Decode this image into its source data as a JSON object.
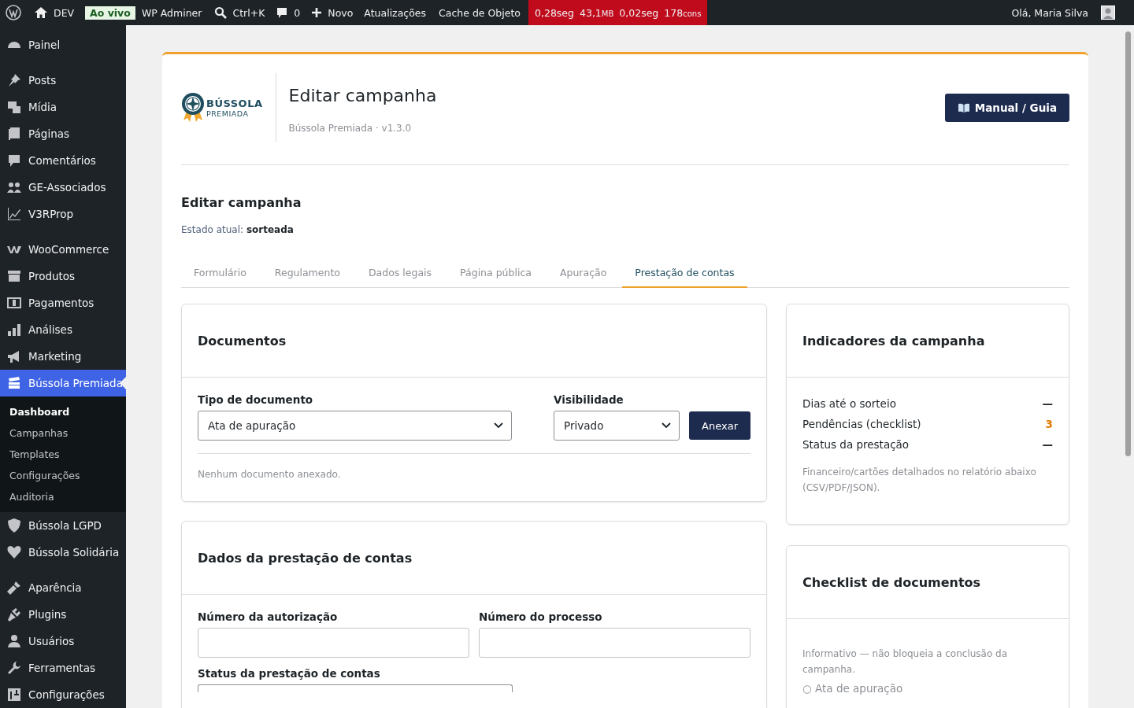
{
  "admin_bar": {
    "site": "DEV",
    "environment_badge": "Ao vivo",
    "adminer": "WP Adminer",
    "search": "Ctrl+K",
    "comments": "0",
    "new": "Novo",
    "links": [
      "Atualizações",
      "Cache de Objeto"
    ],
    "query_monitor": [
      {
        "value": "0,28seg"
      },
      {
        "value": "43,1",
        "unit": "MB"
      },
      {
        "value": "0,02seg"
      },
      {
        "value": "178",
        "unit": "cons"
      }
    ],
    "greeting": "Olá, Maria Silva"
  },
  "sidebar": {
    "groups": [
      [
        {
          "label": "Painel",
          "selected": false
        }
      ],
      [
        {
          "label": "Posts",
          "selected": false
        },
        {
          "label": "Mídia",
          "selected": false
        },
        {
          "label": "Páginas",
          "selected": false
        },
        {
          "label": "Comentários",
          "selected": false
        },
        {
          "label": "GE-Associados",
          "selected": false
        },
        {
          "label": "V3RProp",
          "selected": false
        }
      ],
      [
        {
          "label": "WooCommerce",
          "selected": false
        },
        {
          "label": "Produtos",
          "selected": false
        },
        {
          "label": "Pagamentos",
          "selected": false
        },
        {
          "label": "Análises",
          "selected": false
        },
        {
          "label": "Marketing",
          "selected": false
        },
        {
          "label": "Bússola Premiada",
          "selected": true,
          "children": [
            {
              "label": "Dashboard",
              "selected": true
            },
            {
              "label": "Campanhas",
              "selected": false
            },
            {
              "label": "Templates",
              "selected": false
            },
            {
              "label": "Configurações",
              "selected": false
            },
            {
              "label": "Auditoria",
              "selected": false
            }
          ]
        },
        {
          "label": "Bússola LGPD",
          "selected": false
        },
        {
          "label": "Bússola Solidária",
          "selected": false
        }
      ],
      [
        {
          "label": "Aparência",
          "selected": false
        },
        {
          "label": "Plugins",
          "selected": false
        },
        {
          "label": "Usuários",
          "selected": false
        },
        {
          "label": "Ferramentas",
          "selected": false
        },
        {
          "label": "Configurações",
          "selected": false
        }
      ]
    ]
  },
  "header": {
    "logo_name": "BÚSSOLA",
    "logo_sub": "PREMIADA",
    "title": "Editar campanha",
    "subtitle": "Bússola Premiada · v1.3.0",
    "guide_button": "Manual / Guia"
  },
  "section": {
    "title": "Editar campanha",
    "status": "Estado atual: **sorteada**"
  },
  "tabs": [
    {
      "label": "Formulário",
      "selected": false
    },
    {
      "label": "Regulamento",
      "selected": false
    },
    {
      "label": "Dados legais",
      "selected": false
    },
    {
      "label": "Página pública",
      "selected": false
    },
    {
      "label": "Apuração",
      "selected": false
    },
    {
      "label": "Prestação de contas",
      "selected": true
    }
  ],
  "documents": {
    "title": "Documentos",
    "type_label": "Tipo de documento",
    "type_value": "Ata de apuração",
    "visibility_label": "Visibilidade",
    "visibility_value": "Privado",
    "button": "Anexar",
    "empty": "Nenhum documento anexado."
  },
  "account_data": {
    "title": "Dados da prestação de contas",
    "fields": [
      "Número da autorização",
      "Número do processo"
    ],
    "status_label": "Status da prestação de contas"
  },
  "indicators": {
    "title": "Indicadores da campanha",
    "rows": [
      {
        "label": "Dias até o sorteio",
        "value": "—",
        "highlight": false
      },
      {
        "label": "Pendências (checklist)",
        "value": "3",
        "highlight": true
      },
      {
        "label": "Status da prestação",
        "value": "—",
        "highlight": false
      }
    ],
    "note": "Financeiro/cartões detalhados no relatório abaixo (CSV/PDF/JSON)."
  },
  "checklist": {
    "title": "Checklist de documentos",
    "note": "Informativo — não bloqueia a conclusão da campanha.",
    "items": [
      "○ Ata de apuração"
    ]
  }
}
